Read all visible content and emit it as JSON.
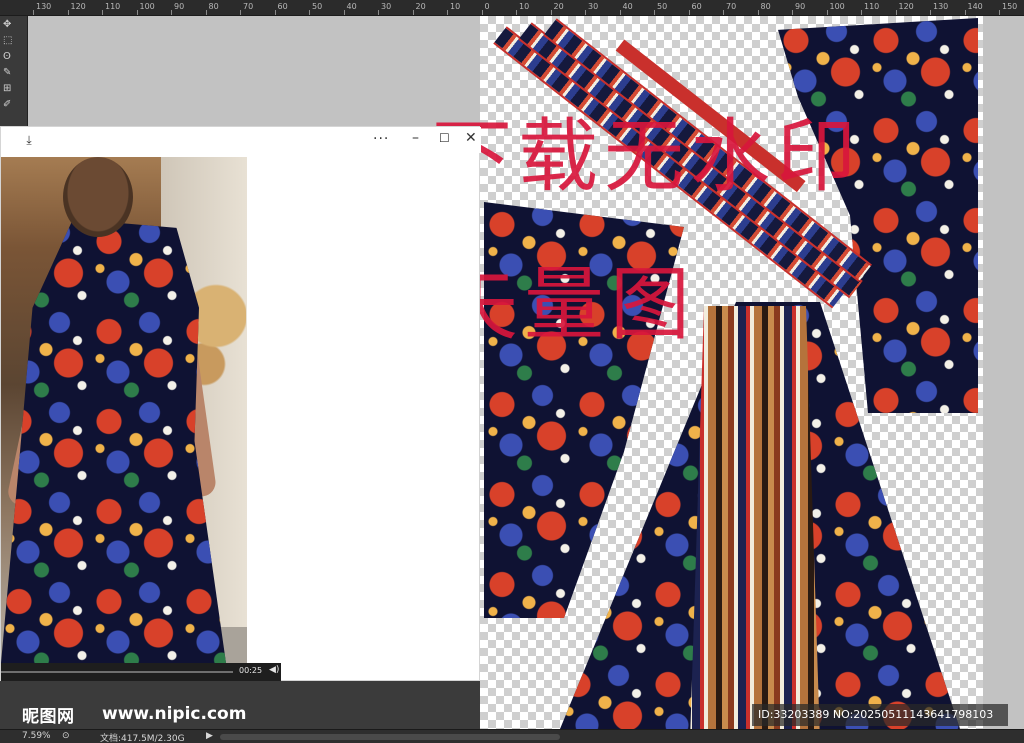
{
  "ruler": {
    "labels": [
      "130",
      "120",
      "110",
      "100",
      "90",
      "80",
      "70",
      "60",
      "50",
      "40",
      "30",
      "20",
      "10",
      "0",
      "10",
      "20",
      "30",
      "40",
      "50",
      "60",
      "70",
      "80",
      "90",
      "100",
      "110",
      "120",
      "130",
      "140",
      "150"
    ]
  },
  "tools": [
    "move-icon",
    "marquee-icon",
    "lasso-icon",
    "quick-select-icon",
    "crop-icon",
    "eyedropper-icon"
  ],
  "watermark": {
    "line1": "下载无水印",
    "line2": "矢量图"
  },
  "viewer": {
    "more": "···",
    "minimize": "–",
    "maximize": "☐",
    "close": "✕",
    "video": {
      "time": "00:25",
      "progress": 0.0
    }
  },
  "footer": {
    "logo_text": "昵图网",
    "site": "www.nipic.com",
    "id_text": "ID:33203389 NO:20250511143641798103"
  },
  "status": {
    "zoom": "7.59%",
    "doc": "文档:417.5M/2.30G",
    "arrow": "▶"
  },
  "colors": {
    "accent_red": "#d8163c",
    "navy": "#0f1233",
    "floral_red": "#d8412a",
    "floral_blue": "#3b4fb3"
  }
}
